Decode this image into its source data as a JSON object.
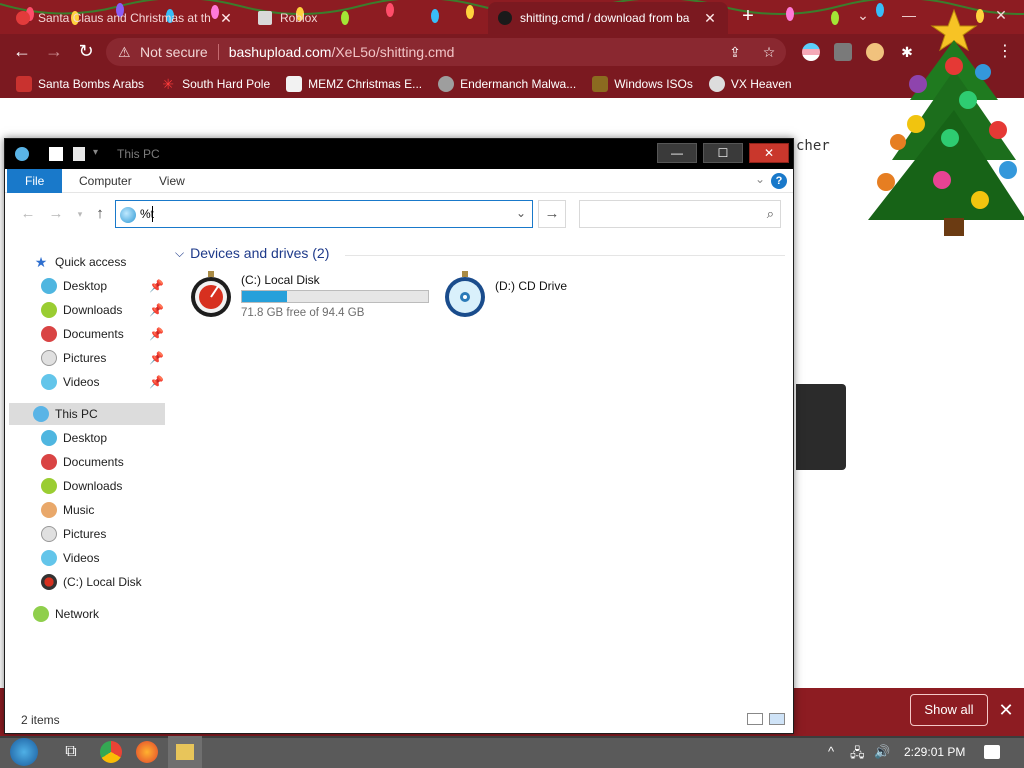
{
  "browser": {
    "tabs": [
      {
        "title": "Santa Claus and Christmas at th",
        "active": false
      },
      {
        "title": "Roblox",
        "active": false
      },
      {
        "title": "shitting.cmd / download from ba",
        "active": true
      }
    ],
    "tab_close": "✕",
    "new_tab": "+",
    "window_controls": {
      "restore_down": "⌄",
      "minimize": "—",
      "close": "✕"
    },
    "omnibox": {
      "security": "Not secure",
      "host": "bashupload.com",
      "path": "/XeL5o/shitting.cmd"
    },
    "bookmarks": [
      {
        "label": "Santa Bombs Arabs",
        "icon": "santa-icon"
      },
      {
        "label": "South Hard Pole",
        "icon": "snowflake-icon"
      },
      {
        "label": "MEMZ Christmas E...",
        "icon": "memz-icon"
      },
      {
        "label": "Endermanch Malwa...",
        "icon": "raccoon-icon"
      },
      {
        "label": "Windows ISOs",
        "icon": "windows-iso-icon"
      },
      {
        "label": "VX Heaven",
        "icon": "vx-heaven-icon"
      }
    ]
  },
  "page": {
    "fragment_text": "cher",
    "download_bar": {
      "show_all": "Show all",
      "close": "✕"
    }
  },
  "explorer": {
    "title": "This PC",
    "ribbon_tabs": [
      "File",
      "Computer",
      "View"
    ],
    "address_value": "%t",
    "search_placeholder": "",
    "nav": {
      "quick_access": {
        "label": "Quick access",
        "items": [
          "Desktop",
          "Downloads",
          "Documents",
          "Pictures",
          "Videos"
        ]
      },
      "this_pc": {
        "label": "This PC",
        "items": [
          "Desktop",
          "Documents",
          "Downloads",
          "Music",
          "Pictures",
          "Videos",
          "(C:) Local Disk"
        ]
      },
      "network": "Network"
    },
    "group_title": "Devices and drives (2)",
    "drives": [
      {
        "name": "(C:) Local Disk",
        "free": "71.8 GB free of 94.4 GB",
        "used_fraction": 0.24
      },
      {
        "name": "(D:) CD Drive"
      }
    ],
    "status_count": "2 items"
  },
  "taskbar": {
    "clock": "2:29:01 PM"
  },
  "colors": {
    "chrome_dark": "#7b1920",
    "chrome_tabstrip": "#8d1c22",
    "explorer_accent": "#1979ca",
    "drive_fill": "#26a0da"
  }
}
